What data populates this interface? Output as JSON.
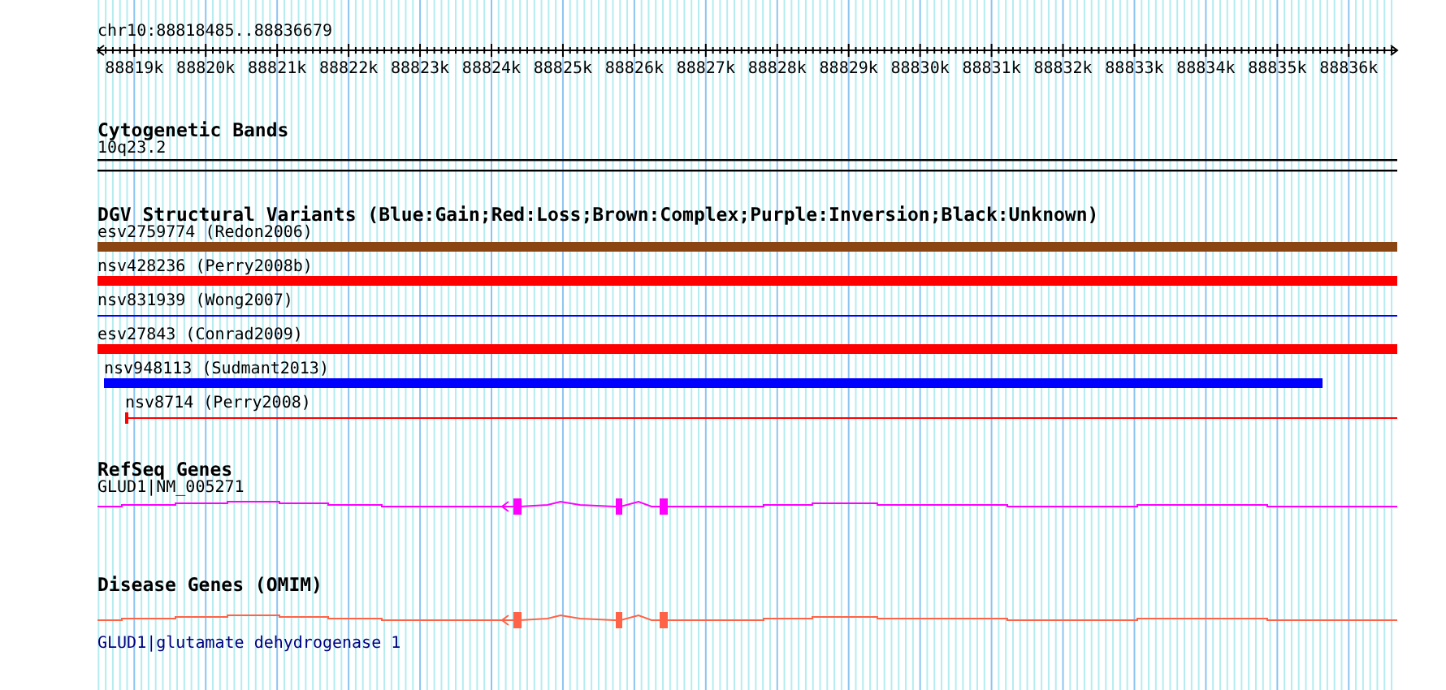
{
  "ruler": {
    "range": "chr10:88818485..88836679",
    "labels": [
      "88819k",
      "88820k",
      "88821k",
      "88822k",
      "88823k",
      "88824k",
      "88825k",
      "88826k",
      "88827k",
      "88828k",
      "88829k",
      "88830k",
      "88831k",
      "88832k",
      "88833k",
      "88834k",
      "88835k",
      "88836k"
    ]
  },
  "cytoband": {
    "heading": "Cytogenetic Bands",
    "label": "10q23.2"
  },
  "dgv": {
    "heading": "DGV Structural Variants (Blue:Gain;Red:Loss;Brown:Complex;Purple:Inversion;Black:Unknown)",
    "variants": [
      {
        "label": "esv2759774 (Redon2006)",
        "kind": "bar",
        "color": "#8b4513"
      },
      {
        "label": "nsv428236 (Perry2008b)",
        "kind": "bar",
        "color": "#ff0000"
      },
      {
        "label": "nsv831939 (Wong2007)",
        "kind": "line",
        "color": "#0000ff"
      },
      {
        "label": "esv27843 (Conrad2009)",
        "kind": "bar",
        "color": "#ff0000"
      },
      {
        "label": "nsv948113 (Sudmant2013)",
        "kind": "bar",
        "color": "#0000ff"
      },
      {
        "label": "nsv8714 (Perry2008)",
        "kind": "line",
        "color": "#ff0000"
      }
    ]
  },
  "gene_tracks": [
    {
      "heading": "RefSeq Genes",
      "kind": "gene",
      "label": "GLUD1|NM_005271",
      "color": "#ff00ff"
    },
    {
      "heading": "Disease Genes (OMIM)",
      "kind": "disease",
      "label": "GLUD1|glutamate dehydrogenase 1",
      "color": "#ff6347"
    }
  ]
}
